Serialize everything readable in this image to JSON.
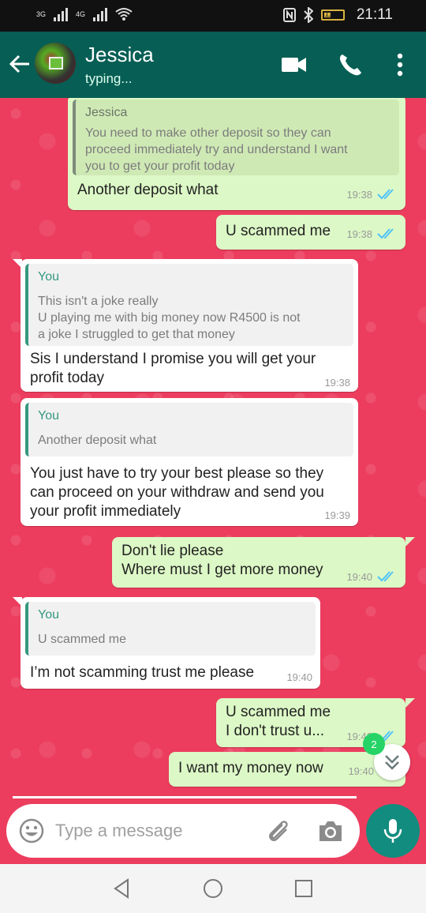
{
  "status_bar": {
    "network_1": "3G",
    "network_2": "4G",
    "battery_level": "11",
    "time": "21:11"
  },
  "header": {
    "contact_name": "Jessica",
    "status": "typing..."
  },
  "messages": [
    {
      "direction": "outgoing",
      "quote_author": "Jessica",
      "quote_text": "You need to make other deposit so they can\nproceed immediately try and understand I want\nyou to get your profit today",
      "text": "Another deposit what",
      "time": "19:38",
      "read": true
    },
    {
      "direction": "outgoing",
      "text": "U scammed me",
      "time": "19:38",
      "read": true
    },
    {
      "direction": "incoming",
      "quote_author": "You",
      "quote_text": "This isn't a joke really\nU playing me with big money now R4500 is not\na joke I struggled to get that money",
      "text": "Sis I understand I promise you will get your\nprofit today",
      "time": "19:38"
    },
    {
      "direction": "incoming",
      "quote_author": "You",
      "quote_text": "Another deposit what",
      "text": "You just have to try your best please so they\ncan proceed on your withdraw and send you\nyour profit immediately",
      "time": "19:39"
    },
    {
      "direction": "outgoing",
      "text": "Don't lie please\nWhere must I get more money",
      "time": "19:40",
      "read": true
    },
    {
      "direction": "incoming",
      "quote_author": "You",
      "quote_text": "U scammed me",
      "text": "I’m not scamming trust me please",
      "time": "19:40"
    },
    {
      "direction": "outgoing",
      "text": "U scammed me\nI don't trust u...",
      "time": "19:40",
      "read": true
    },
    {
      "direction": "outgoing",
      "text": "I want my money now",
      "time": "19:40"
    }
  ],
  "unread_count": "2",
  "composer": {
    "placeholder": "Type a message"
  },
  "colors": {
    "header": "#075e54",
    "chat_background": "#ec3d5e",
    "outgoing_bubble": "#dcf8c6",
    "incoming_bubble": "#ffffff",
    "read_ticks": "#4fc3f7",
    "mic_button": "#128c7e"
  },
  "icons": {
    "header": [
      "back-arrow-icon",
      "video-call-icon",
      "phone-icon",
      "more-options-icon"
    ],
    "composer": [
      "emoji-icon",
      "attach-icon",
      "camera-icon",
      "mic-icon"
    ],
    "navigation": [
      "nav-back-icon",
      "nav-home-icon",
      "nav-recents-icon"
    ]
  }
}
